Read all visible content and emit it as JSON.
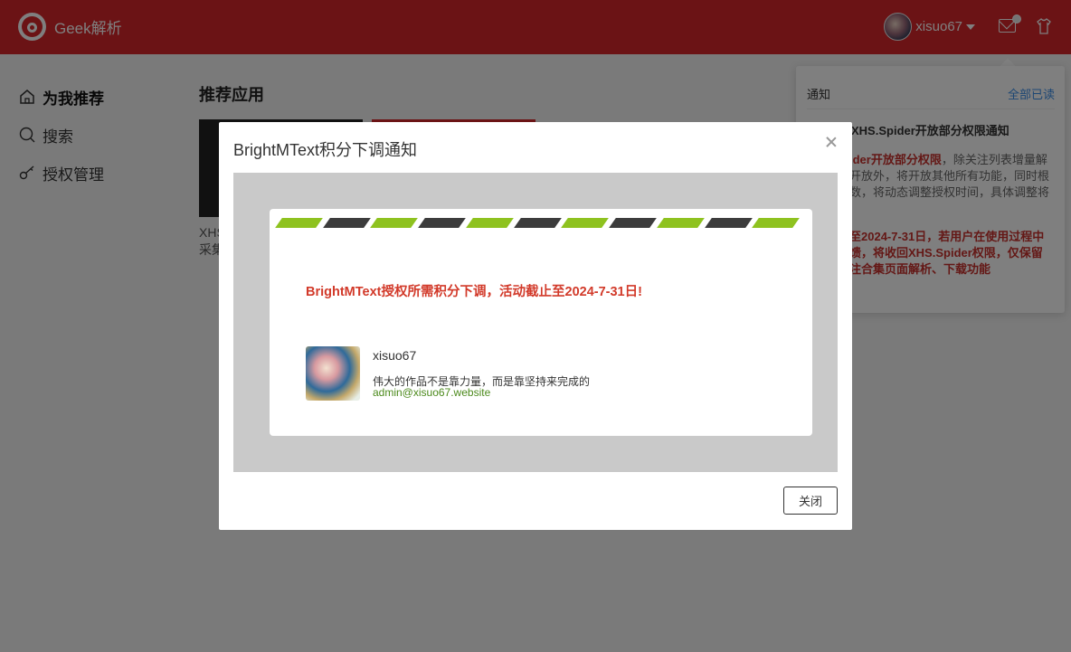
{
  "header": {
    "app_title": "Geek解析",
    "username": "xisuo67",
    "icons": [
      "app-logo-icon",
      "user-avatar",
      "chevron-down-icon",
      "mail-icon",
      "shirt-icon"
    ]
  },
  "sidebar": {
    "items": [
      {
        "label": "为我推荐",
        "icon": "home-icon",
        "active": true
      },
      {
        "label": "搜索",
        "icon": "search-icon",
        "active": false
      },
      {
        "label": "授权管理",
        "icon": "key-icon",
        "active": false
      }
    ]
  },
  "main": {
    "section_title": "推荐应用",
    "card_text_line1": "XHS",
    "card_text_line2": "采集"
  },
  "notifications": {
    "title": "通知",
    "mark_all": "全部已读",
    "item_title": "XHS.Spider开放部分权限通知",
    "body_red": "ider开放部分权限",
    "body_rest_1": "，除关注列表增量解",
    "body_line2": "开放外，将开放其他所有功能，同时根",
    "body_line3": "数，将动态调整授权时间，具体调整将",
    "body_line4": "!",
    "body2_line1": "至2024-7-31日，若用户在使用过程中",
    "body2_line2": "馈，将收回XHS.Spider权限，仅保留",
    "body2_line3": "注合集页面解析、下载功能"
  },
  "modal": {
    "title": "BrightMText积分下调通知",
    "notice": "BrightMText授权所需积分下调，活动截止至2024-7-31日!",
    "signature": {
      "name": "xisuo67",
      "quote": "伟大的作品不是靠力量，而是靠坚持来完成的",
      "email": "admin@xisuo67.website"
    },
    "close_button": "关闭"
  },
  "colors": {
    "brand_red": "#d7262a",
    "notice_red": "#d23a2a",
    "stripe_green": "#8ec21f",
    "stripe_dark": "#3c3c3c",
    "link_blue": "#3b8ee8",
    "email_green": "#4c8a1c"
  }
}
